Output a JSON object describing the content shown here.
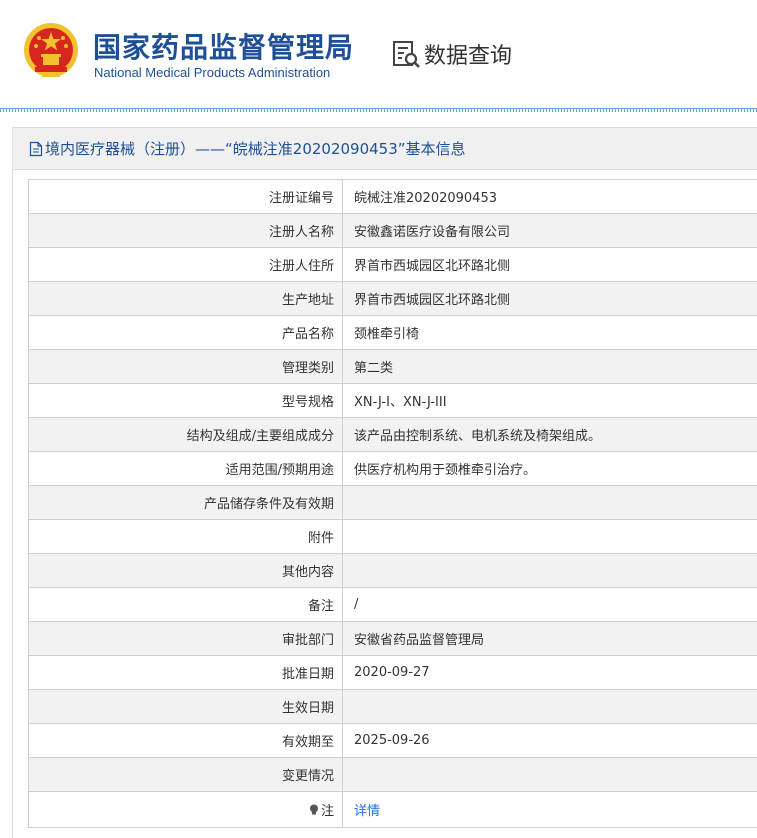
{
  "header": {
    "org_name_cn": "国家药品监督管理局",
    "org_name_en": "National Medical Products Administration",
    "query_label": "数据查询"
  },
  "panel": {
    "title": "境内医疗器械（注册）——“皖械注准20202090453”基本信息"
  },
  "rows": [
    {
      "label": "注册证编号",
      "value": "皖械注准20202090453"
    },
    {
      "label": "注册人名称",
      "value": "安徽鑫诺医疗设备有限公司"
    },
    {
      "label": "注册人住所",
      "value": "界首市西城园区北环路北侧"
    },
    {
      "label": "生产地址",
      "value": "界首市西城园区北环路北侧"
    },
    {
      "label": "产品名称",
      "value": "颈椎牵引椅"
    },
    {
      "label": "管理类别",
      "value": "第二类"
    },
    {
      "label": "型号规格",
      "value": "XN-J-I、XN-J-III"
    },
    {
      "label": "结构及组成/主要组成成分",
      "value": "该产品由控制系统、电机系统及椅架组成。"
    },
    {
      "label": "适用范围/预期用途",
      "value": "供医疗机构用于颈椎牵引治疗。"
    },
    {
      "label": "产品储存条件及有效期",
      "value": ""
    },
    {
      "label": "附件",
      "value": ""
    },
    {
      "label": "其他内容",
      "value": ""
    },
    {
      "label": "备注",
      "value": "/"
    },
    {
      "label": "审批部门",
      "value": "安徽省药品监督管理局"
    },
    {
      "label": "批准日期",
      "value": "2020-09-27"
    },
    {
      "label": "生效日期",
      "value": ""
    },
    {
      "label": "有效期至",
      "value": "2025-09-26"
    },
    {
      "label": "变更情况",
      "value": ""
    }
  ],
  "note_row": {
    "label": "注",
    "icon": "lightbulb-icon",
    "link_text": "详情"
  },
  "colors": {
    "brand_blue": "#1e4f97",
    "link_blue": "#1e6fd8",
    "emblem_red": "#d7261b",
    "emblem_gold": "#f2c12e"
  }
}
